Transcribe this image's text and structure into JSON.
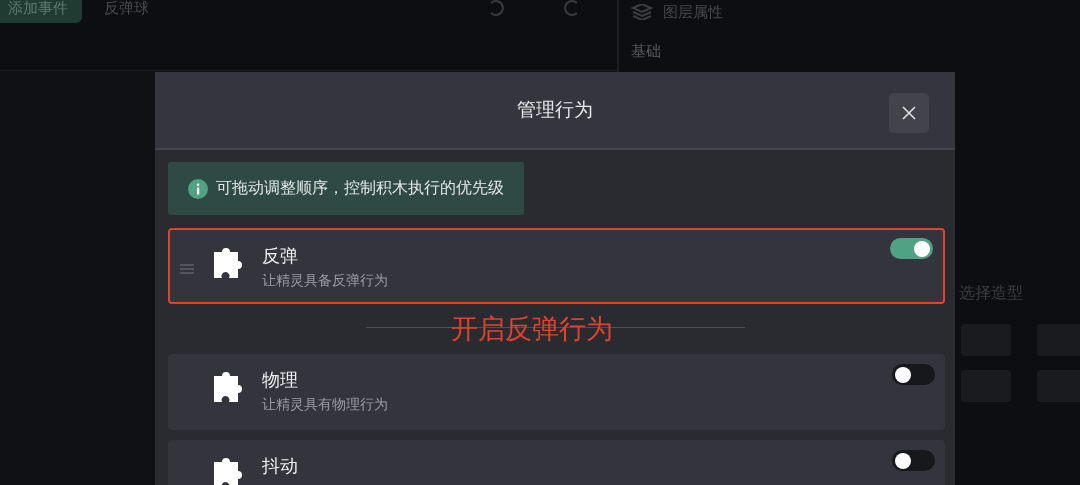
{
  "toolbar": {
    "add_button": "添加事件",
    "title": "反弹球"
  },
  "properties_panel": {
    "title": "图层属性",
    "section": "基础",
    "costume_label": "选择造型"
  },
  "dialog": {
    "title": "管理行为",
    "hint": "可拖动调整顺序，控制积木执行的优先级",
    "behaviors": [
      {
        "name": "反弹",
        "description": "让精灵具备反弹行为",
        "on": true,
        "highlighted": true
      },
      {
        "name": "物理",
        "description": "让精灵具有物理行为",
        "on": false,
        "highlighted": false
      },
      {
        "name": "抖动",
        "on": false,
        "highlighted": false
      }
    ],
    "annotation": "开启反弹行为"
  }
}
